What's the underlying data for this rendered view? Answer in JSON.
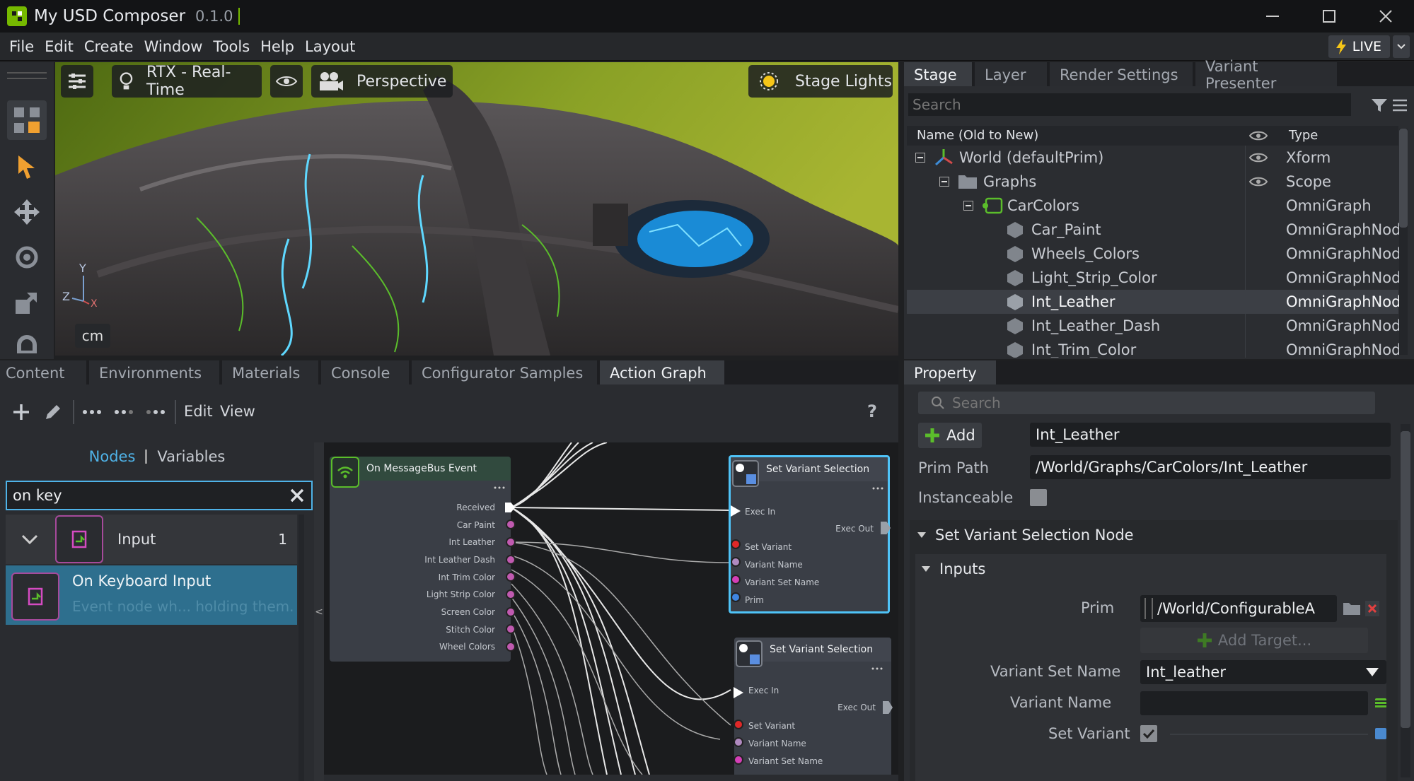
{
  "window": {
    "title": "My USD Composer",
    "version": "0.1.0",
    "live_label": "LIVE"
  },
  "menu": [
    "File",
    "Edit",
    "Create",
    "Window",
    "Tools",
    "Help",
    "Layout"
  ],
  "viewport": {
    "renderer": "RTX - Real-Time",
    "camera": "Perspective",
    "lights": "Stage Lights",
    "units": "cm",
    "axis_y": "Y",
    "axis_z": "Z",
    "axis_x": "X"
  },
  "stage": {
    "tabs": [
      "Stage",
      "Layer",
      "Render Settings",
      "Variant Presenter"
    ],
    "search_placeholder": "Search",
    "col_name": "Name (Old to New)",
    "col_type": "Type",
    "rows": [
      {
        "name": "World (defaultPrim)",
        "type": "Xform"
      },
      {
        "name": "Graphs",
        "type": "Scope"
      },
      {
        "name": "CarColors",
        "type": "OmniGraph"
      },
      {
        "name": "Car_Paint",
        "type": "OmniGraphNod"
      },
      {
        "name": "Wheels_Colors",
        "type": "OmniGraphNod"
      },
      {
        "name": "Light_Strip_Color",
        "type": "OmniGraphNod"
      },
      {
        "name": "Int_Leather",
        "type": "OmniGraphNod"
      },
      {
        "name": "Int_Leather_Dash",
        "type": "OmniGraphNod"
      },
      {
        "name": "Int_Trim_Color",
        "type": "OmniGraphNod"
      }
    ]
  },
  "bottom": {
    "tabs": [
      "Content",
      "Environments",
      "Materials",
      "Console",
      "Configurator Samples",
      "Action Graph"
    ],
    "edit": "Edit",
    "view": "View",
    "help": "?",
    "nodes_tab": "Nodes",
    "variables_tab": "Variables",
    "search_value": "on key",
    "category": {
      "label": "Input",
      "count": "1"
    },
    "result": {
      "title": "On Keyboard Input",
      "desc": "Event node wh... holding them."
    },
    "collapse": "<"
  },
  "graph": {
    "msgbus": {
      "title": "On MessageBus Event",
      "ports": [
        "Received",
        "Car Paint",
        "Int Leather",
        "Int Leather Dash",
        "Int Trim Color",
        "Light Strip Color",
        "Screen Color",
        "Stitch Color",
        "Wheel Colors"
      ]
    },
    "svs1": {
      "title": "Set Variant Selection",
      "exec_in": "Exec In",
      "exec_out": "Exec Out",
      "inputs": [
        "Set Variant",
        "Variant Name",
        "Variant Set Name",
        "Prim"
      ]
    },
    "svs2": {
      "title": "Set Variant Selection",
      "exec_in": "Exec In",
      "exec_out": "Exec Out",
      "inputs": [
        "Set Variant",
        "Variant Name",
        "Variant Set Name"
      ]
    }
  },
  "property": {
    "tab": "Property",
    "search_placeholder": "Search",
    "add_label": "Add",
    "name_value": "Int_Leather",
    "prim_path_label": "Prim Path",
    "prim_path_value": "/World/Graphs/CarColors/Int_Leather",
    "instanceable_label": "Instanceable",
    "section": "Set Variant Selection Node",
    "inputs_label": "Inputs",
    "prim_label": "Prim",
    "prim_value": "/World/ConfigurableA",
    "add_target": "Add Target...",
    "variant_set_name_label": "Variant Set Name",
    "variant_set_name_value": "Int_leather",
    "variant_name_label": "Variant Name",
    "set_variant_label": "Set Variant"
  },
  "colors": {
    "accent": "#76b900",
    "selection": "#4fc3f7",
    "result_bg": "#2e6f8e"
  }
}
